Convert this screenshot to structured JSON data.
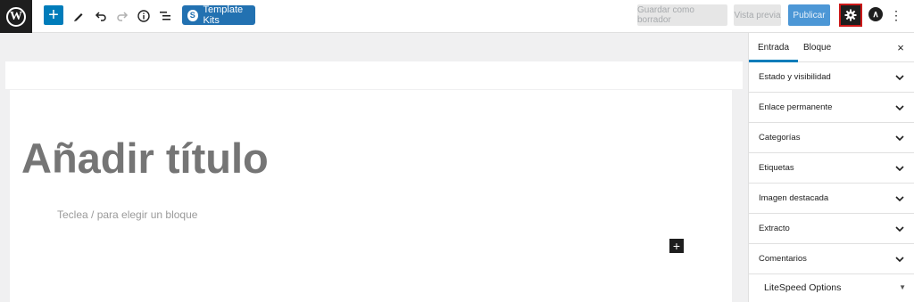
{
  "toolbar": {
    "add_label": "+",
    "template_kits_label": "Template Kits",
    "save_draft_label": "Guardar como borrador",
    "preview_label": "Vista previa",
    "publish_label": "Publicar"
  },
  "editor": {
    "title_placeholder": "Añadir título",
    "block_placeholder": "Teclea / para elegir un bloque",
    "add_block_label": "+"
  },
  "sidebar": {
    "tabs": [
      {
        "label": "Entrada"
      },
      {
        "label": "Bloque"
      }
    ],
    "close_label": "×",
    "panels": [
      {
        "label": "Estado y visibilidad"
      },
      {
        "label": "Enlace permanente"
      },
      {
        "label": "Categorías"
      },
      {
        "label": "Etiquetas"
      },
      {
        "label": "Imagen destacada"
      },
      {
        "label": "Extracto"
      },
      {
        "label": "Comentarios"
      }
    ],
    "litespeed_label": "LiteSpeed Options"
  },
  "colors": {
    "accent": "#007cba",
    "template_kits": "#2271b1",
    "publish": "#4c97d6",
    "settings_highlight": "#cc1818"
  },
  "icons": [
    "wordpress-icon",
    "plus-icon",
    "pen-icon",
    "undo-icon",
    "redo-icon",
    "info-icon",
    "list-view-icon",
    "gear-icon",
    "astra-icon",
    "more-vertical-icon",
    "close-icon",
    "chevron-down-icon"
  ]
}
